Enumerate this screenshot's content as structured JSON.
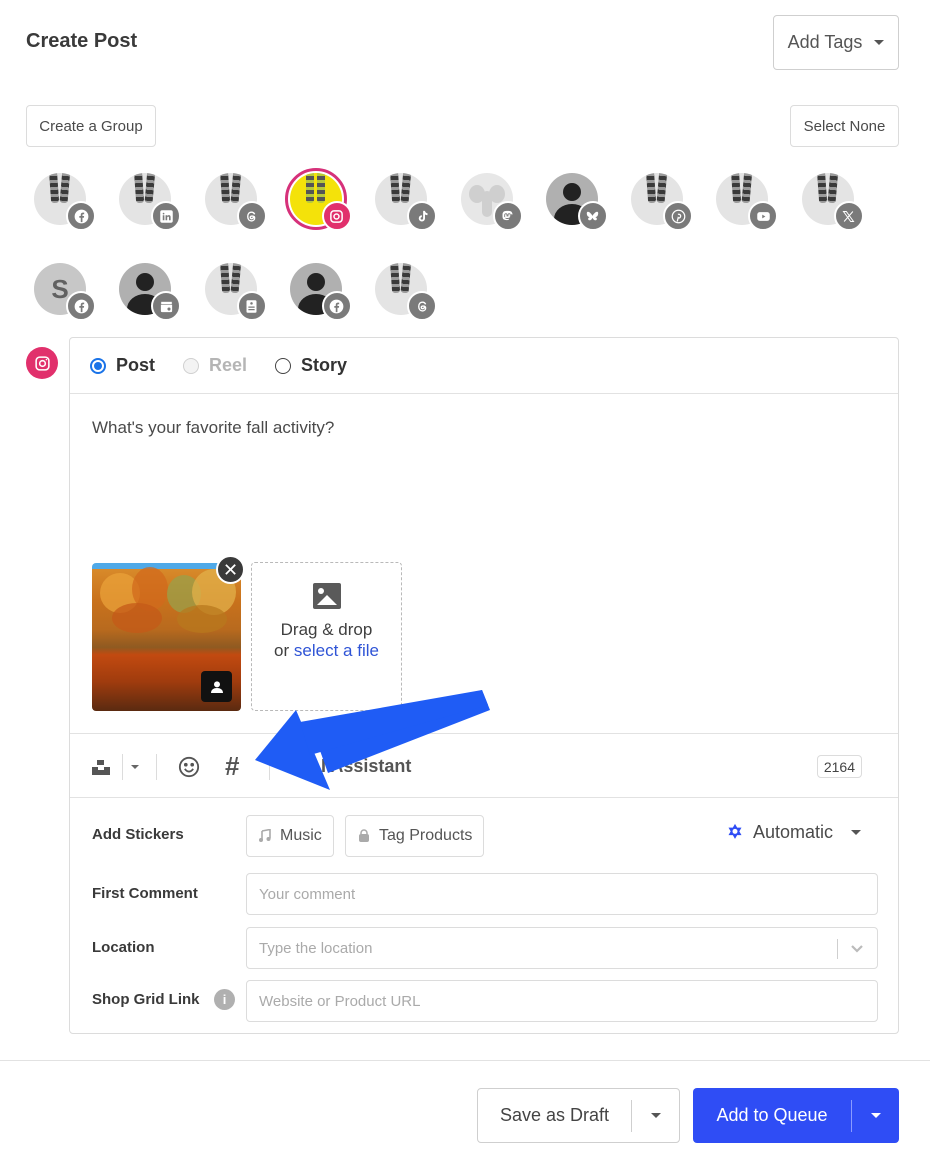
{
  "header": {
    "title": "Create Post",
    "add_tags_label": "Add Tags"
  },
  "groups": {
    "create_group_label": "Create a Group",
    "select_none_label": "Select None"
  },
  "accounts": [
    {
      "network": "facebook",
      "avatar": "feet-photo",
      "selected": false
    },
    {
      "network": "linkedin",
      "avatar": "feet-photo",
      "selected": false
    },
    {
      "network": "threads",
      "avatar": "feet-photo",
      "selected": false
    },
    {
      "network": "instagram",
      "avatar": "feet-photo-yellow",
      "selected": true
    },
    {
      "network": "tiktok",
      "avatar": "feet-photo",
      "selected": false
    },
    {
      "network": "mastodon",
      "avatar": "elephant",
      "selected": false
    },
    {
      "network": "bluesky",
      "avatar": "default-person",
      "selected": false
    },
    {
      "network": "pinterest",
      "avatar": "feet-photo",
      "selected": false
    },
    {
      "network": "youtube",
      "avatar": "feet-photo",
      "selected": false
    },
    {
      "network": "x",
      "avatar": "feet-photo",
      "selected": false
    },
    {
      "network": "facebook",
      "avatar": "letter",
      "letter": "S",
      "selected": false
    },
    {
      "network": "google-business",
      "avatar": "default-person",
      "selected": false
    },
    {
      "network": "start-page",
      "avatar": "feet-photo",
      "selected": false
    },
    {
      "network": "facebook",
      "avatar": "default-person",
      "selected": false
    },
    {
      "network": "threads",
      "avatar": "feet-photo",
      "selected": false
    }
  ],
  "composer": {
    "network_icon": "instagram-icon",
    "post_types": [
      {
        "label": "Post",
        "state": "checked"
      },
      {
        "label": "Reel",
        "state": "disabled"
      },
      {
        "label": "Story",
        "state": "unchecked"
      }
    ],
    "text": "What's your favorite fall activity?",
    "media": {
      "image_alt": "Autumn forest reflected in a lake",
      "dropzone_line1": "Drag & drop",
      "dropzone_or": "or",
      "dropzone_link": "select a file"
    },
    "toolbar": {
      "ai_assistant_label": "AI Assistant",
      "char_count": "2164"
    },
    "stickers": {
      "label": "Add Stickers",
      "music_label": "Music",
      "tag_products_label": "Tag Products",
      "automatic_label": "Automatic"
    },
    "first_comment": {
      "label": "First Comment",
      "placeholder": "Your comment",
      "value": ""
    },
    "location": {
      "label": "Location",
      "placeholder": "Type the location",
      "value": ""
    },
    "shop_grid": {
      "label": "Shop Grid Link",
      "placeholder": "Website or Product URL",
      "value": ""
    }
  },
  "footer": {
    "save_draft_label": "Save as Draft",
    "add_queue_label": "Add to Queue"
  },
  "colors": {
    "primary": "#2f4df5",
    "instagram": "#e1306c",
    "link": "#2f54d6",
    "annotation_arrow": "#1f5cf5"
  }
}
